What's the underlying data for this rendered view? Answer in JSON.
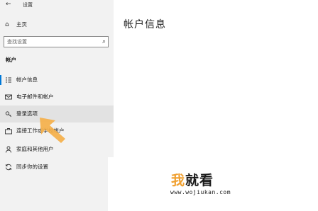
{
  "titlebar": {
    "back_icon": "back-arrow-icon",
    "title": "设置"
  },
  "home": {
    "icon": "home-icon",
    "label": "主页"
  },
  "search": {
    "placeholder": "查找设置",
    "icon": "search-icon"
  },
  "sidebar": {
    "section_title": "帐户",
    "items": [
      {
        "icon": "account-info-icon",
        "label": "帐户信息",
        "active": true
      },
      {
        "icon": "mail-icon",
        "label": "电子邮件和帐户"
      },
      {
        "icon": "key-icon",
        "label": "登录选项",
        "hovered": true
      },
      {
        "icon": "briefcase-icon",
        "label": "连接工作或学校帐户"
      },
      {
        "icon": "family-icon",
        "label": "家庭和其他用户"
      },
      {
        "icon": "sync-icon",
        "label": "同步你的设置"
      }
    ]
  },
  "main": {
    "title": "帐户信息"
  },
  "watermark": {
    "brand_1": "我",
    "brand_2": "就看",
    "url": "www.wojiukan.com"
  },
  "colors": {
    "accent": "#0078d7",
    "pointer": "#f5b04a",
    "sidebar_bg": "#f2f2f2"
  }
}
